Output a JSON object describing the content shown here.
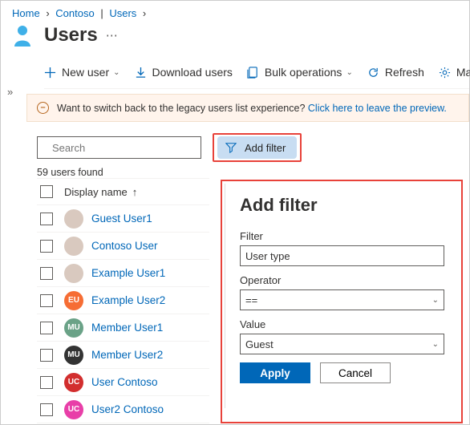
{
  "breadcrumb": {
    "home": "Home",
    "org": "Contoso",
    "section": "Users"
  },
  "title": "Users",
  "toolbar": {
    "new_user": "New user",
    "download": "Download users",
    "bulk": "Bulk operations",
    "refresh": "Refresh",
    "manage": "Mar"
  },
  "banner": {
    "text": "Want to switch back to the legacy users list experience? ",
    "link": "Click here to leave the preview."
  },
  "search": {
    "placeholder": "Search"
  },
  "add_filter_btn": "Add filter",
  "count_text": "59 users found",
  "columns": {
    "display_name": "Display name"
  },
  "users": [
    {
      "name": "Guest User1",
      "avatar": "photo1"
    },
    {
      "name": "Contoso User",
      "avatar": "photo2"
    },
    {
      "name": "Example User1",
      "avatar": "photo3"
    },
    {
      "name": "Example User2",
      "avatar": "EU",
      "color": "av-eu"
    },
    {
      "name": "Member User1",
      "avatar": "MU",
      "color": "av-mu"
    },
    {
      "name": "Member User2",
      "avatar": "MU",
      "color": "av-mu2"
    },
    {
      "name": "User Contoso",
      "avatar": "UC",
      "color": "av-uc"
    },
    {
      "name": "User2 Contoso",
      "avatar": "UC",
      "color": "av-uc2"
    }
  ],
  "panel": {
    "title": "Add filter",
    "filter_label": "Filter",
    "filter_value": "User type",
    "operator_label": "Operator",
    "operator_value": "==",
    "value_label": "Value",
    "value_value": "Guest",
    "apply": "Apply",
    "cancel": "Cancel"
  }
}
